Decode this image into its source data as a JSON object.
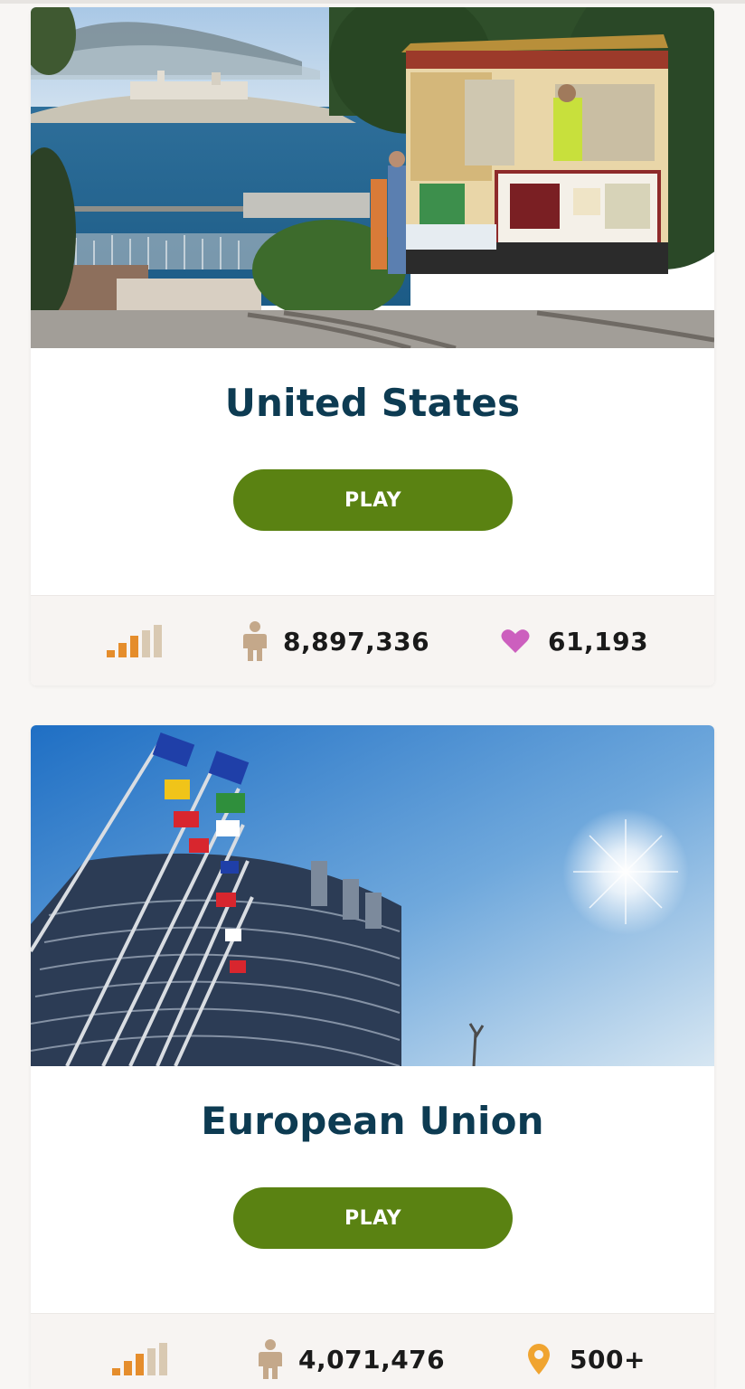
{
  "cards": [
    {
      "title": "United States",
      "play_label": "PLAY",
      "difficulty_icon": "signal-bars-icon",
      "players_icon": "person-icon",
      "players": "8,897,336",
      "secondary_icon": "heart-icon",
      "secondary_value": "61,193"
    },
    {
      "title": "European Union",
      "play_label": "PLAY",
      "difficulty_icon": "signal-bars-icon",
      "players_icon": "person-icon",
      "players": "4,071,476",
      "secondary_icon": "map-pin-icon",
      "secondary_value": "500+"
    }
  ],
  "colors": {
    "title": "#0d3b52",
    "play_button": "#5a8212",
    "stats_bg": "#f7f4f2",
    "bars_active": "#e58d2c",
    "bars_inactive": "#d9c9b2",
    "person_icon": "#c4a88a",
    "heart_icon": "#cc5fbe",
    "pin_icon": "#f0a430"
  }
}
